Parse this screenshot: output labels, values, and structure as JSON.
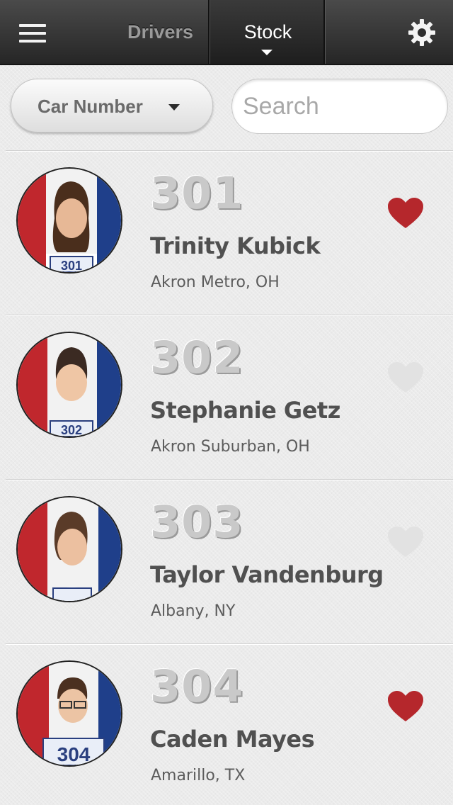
{
  "nav": {
    "drivers_label": "Drivers",
    "stock_label": "Stock",
    "icons": {
      "menu": "hamburger-menu-icon",
      "settings": "gear-icon",
      "active_caret": "caret-down-icon"
    }
  },
  "filter": {
    "sort_label": "Car Number",
    "search_placeholder": "Search"
  },
  "drivers": [
    {
      "number": "301",
      "name": "Trinity Kubick",
      "location": "Akron Metro, OH",
      "favorite": true
    },
    {
      "number": "302",
      "name": "Stephanie Getz",
      "location": "Akron Suburban, OH",
      "favorite": false
    },
    {
      "number": "303",
      "name": "Taylor Vandenburg",
      "location": "Albany, NY",
      "favorite": false
    },
    {
      "number": "304",
      "name": "Caden Mayes",
      "location": "Amarillo, TX",
      "favorite": true
    }
  ],
  "colors": {
    "favorite_on": "#b5272c",
    "favorite_off": "#e2e2e2",
    "flag_red": "#c0272d",
    "flag_blue": "#1f3f8a"
  }
}
